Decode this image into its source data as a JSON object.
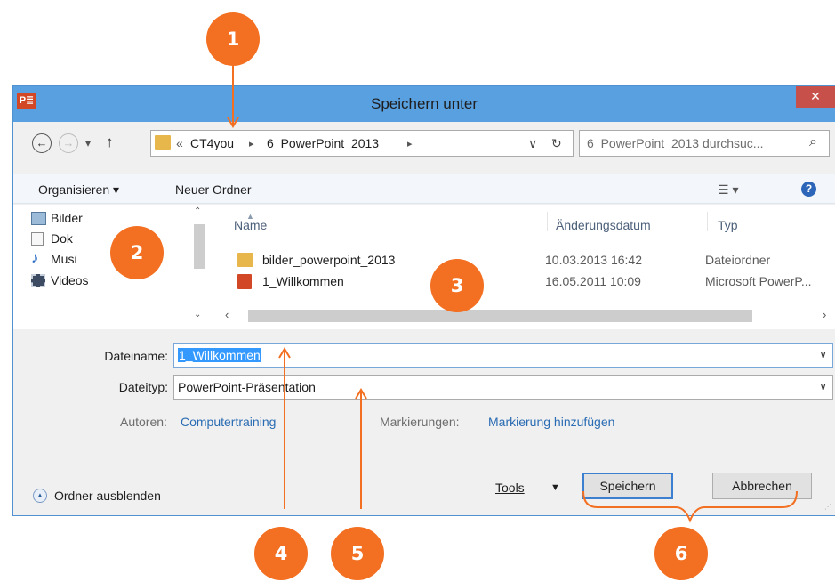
{
  "window": {
    "title": "Speichern unter",
    "app_icon": "P≣",
    "close": "✕"
  },
  "address": {
    "chevrons": "«",
    "path": [
      "CT4you",
      "6_PowerPoint_2013"
    ],
    "separator": "▸",
    "dropdown": "∨",
    "refresh": "↻",
    "search_placeholder": "6_PowerPoint_2013 durchsuc...",
    "search_icon": "⌕"
  },
  "toolbar": {
    "organize": "Organisieren ▾",
    "new_folder": "Neuer Ordner",
    "help": "?"
  },
  "nav_pane": {
    "items": [
      "Bilder",
      "Dok",
      "Musi",
      "Videos"
    ]
  },
  "file_list": {
    "columns": [
      "Name",
      "Änderungsdatum",
      "Typ"
    ],
    "rows": [
      {
        "name": "bilder_powerpoint_2013",
        "date": "10.03.2013 16:42",
        "type": "Dateiordner"
      },
      {
        "name": "1_Willkommen",
        "date": "16.05.2011 10:09",
        "type": "Microsoft PowerP..."
      }
    ]
  },
  "form": {
    "filename_label": "Dateiname:",
    "filename_value": "1_Willkommen",
    "filetype_label": "Dateityp:",
    "filetype_value": "PowerPoint-Präsentation",
    "authors_label": "Autoren:",
    "authors_value": "Computertraining",
    "tags_label": "Markierungen:",
    "tags_value": "Markierung hinzufügen"
  },
  "bottom": {
    "hide_folders": "Ordner ausblenden",
    "tools": "Tools",
    "save": "Speichern",
    "cancel": "Abbrechen"
  },
  "markers": [
    "1",
    "2",
    "3",
    "4",
    "5",
    "6"
  ],
  "colors": {
    "marker": "#f36f21",
    "titlebar": "#59a0e0",
    "close": "#c7504a",
    "selection": "#3399ff",
    "link": "#2a6cb3"
  }
}
